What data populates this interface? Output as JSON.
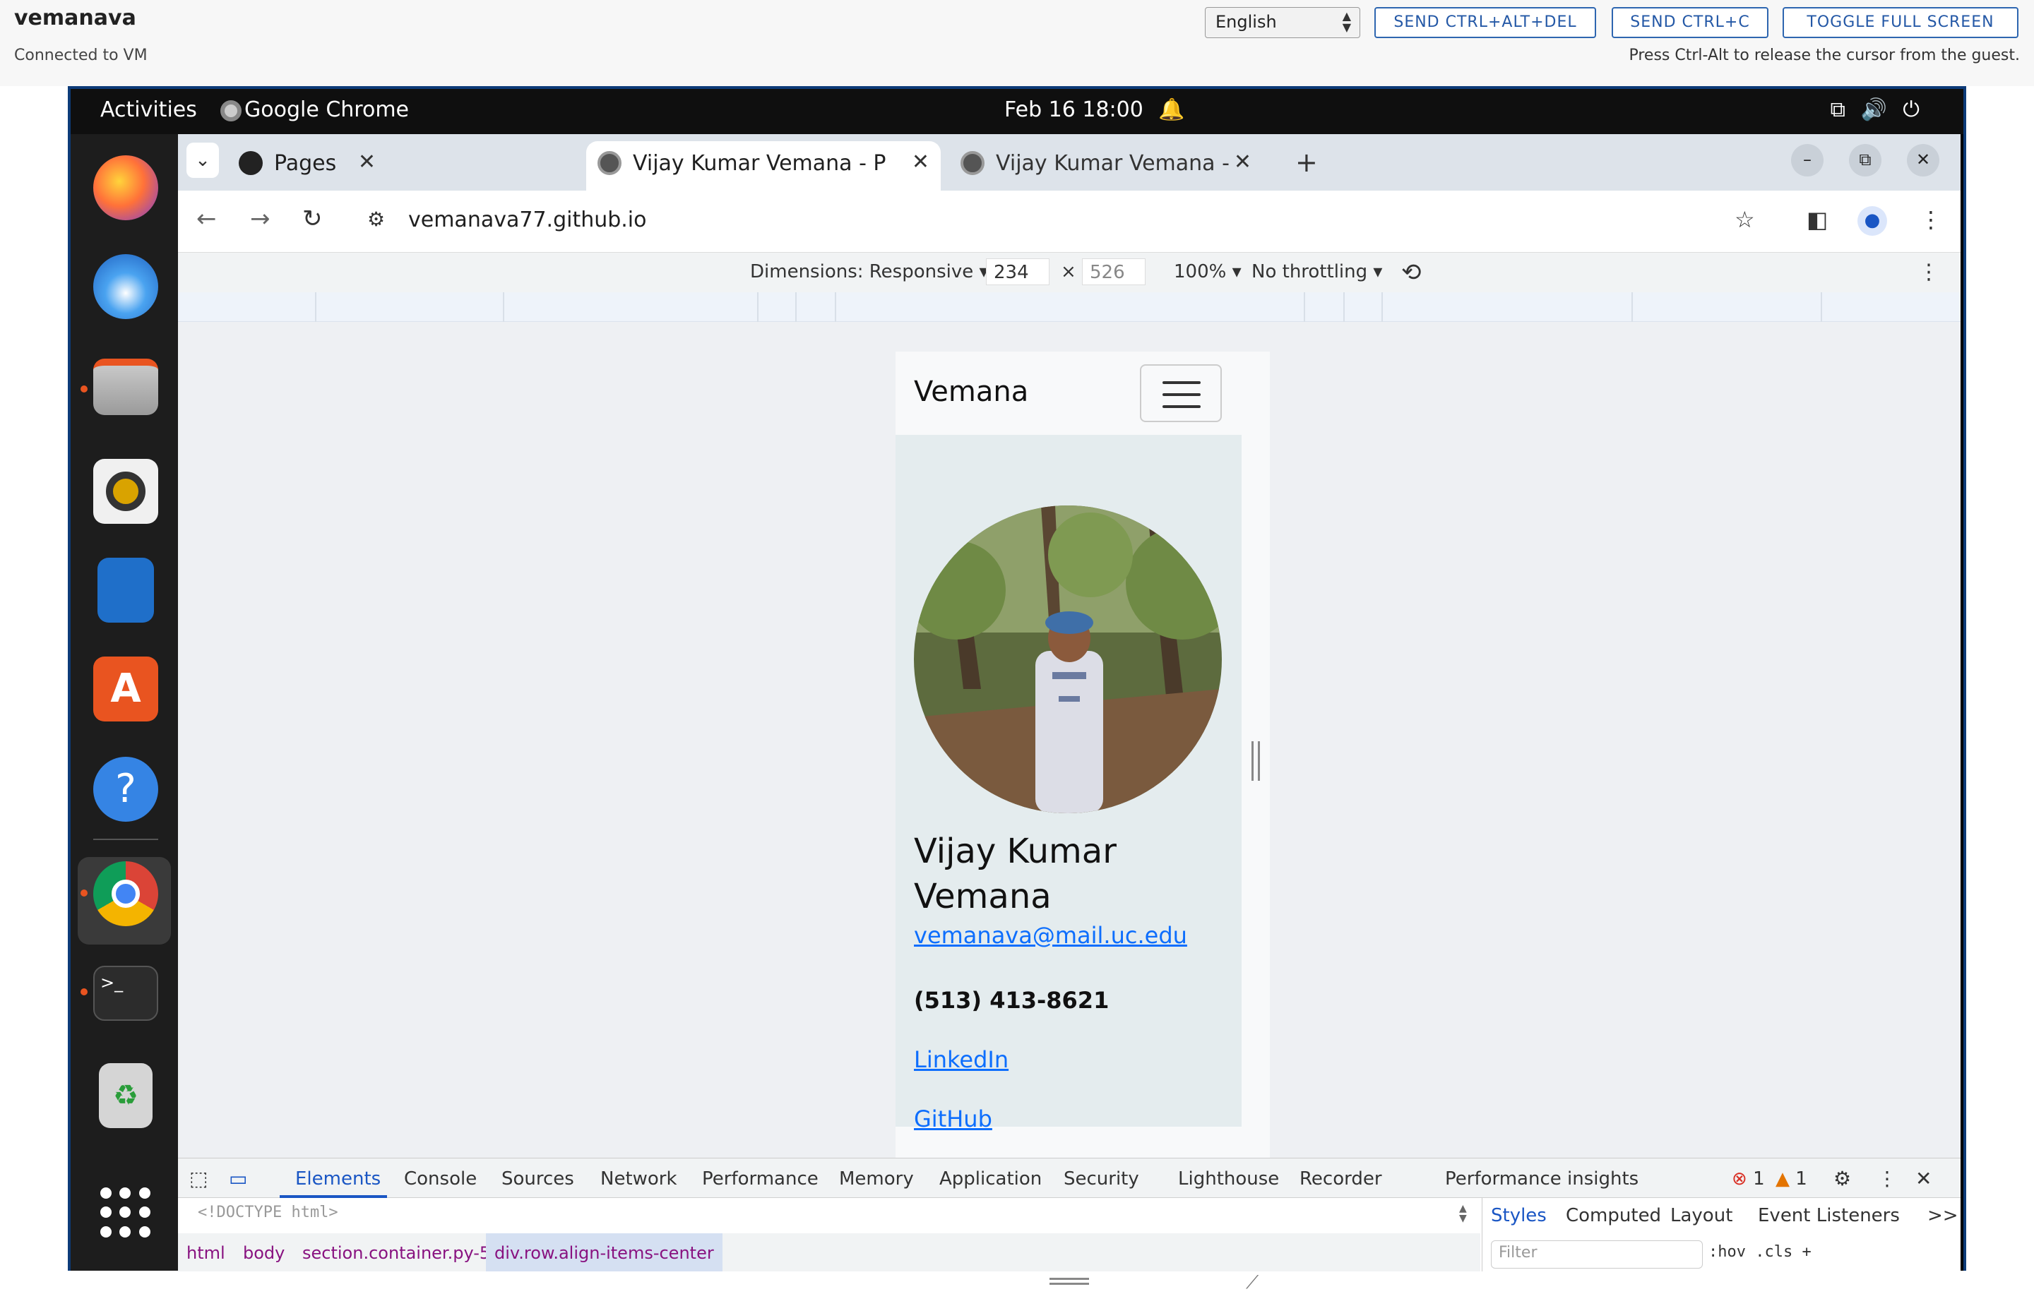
{
  "vm": {
    "title": "vemanava",
    "status": "Connected to VM",
    "language": "English",
    "buttons": [
      "SEND CTRL+ALT+DEL",
      "SEND CTRL+C",
      "TOGGLE FULL SCREEN"
    ],
    "hint": "Press Ctrl-Alt to release the cursor from the guest."
  },
  "topbar": {
    "activities": "Activities",
    "app": "Google Chrome",
    "clock": "Feb 16  18:00"
  },
  "dock": {
    "icons": [
      "firefox-icon",
      "thunderbird-icon",
      "files-icon",
      "rhythmbox-icon",
      "writer-icon",
      "app-center-icon",
      "help-icon",
      "chrome-icon",
      "terminal-icon",
      "trash-icon",
      "show-apps-icon"
    ]
  },
  "chrome": {
    "tabs": [
      {
        "label": "Pages",
        "active": false
      },
      {
        "label": "Vijay Kumar Vemana - Pr",
        "active": true
      },
      {
        "label": "Vijay Kumar Vemana - Pr",
        "active": false
      }
    ],
    "url": "vemanava77.github.io"
  },
  "device_toolbar": {
    "dimensions": "Dimensions: Responsive ▾",
    "width": "234",
    "times": "×",
    "height": "526",
    "zoom": "100% ▾",
    "throttle": "No throttling ▾"
  },
  "page": {
    "brand": "Vemana",
    "name": "Vijay Kumar Vemana",
    "email": "vemanava@mail.uc.edu",
    "phone": "(513) 413-8621",
    "linkedin": "LinkedIn",
    "github": "GitHub"
  },
  "devtools": {
    "tabs": [
      "Elements",
      "Console",
      "Sources",
      "Network",
      "Performance",
      "Memory",
      "Application",
      "Security",
      "Lighthouse",
      "Recorder",
      "Performance insights"
    ],
    "errors": "1",
    "warnings": "1",
    "dom_line": "<!DOCTYPE html>",
    "breadcrumbs": [
      "html",
      "body",
      "section.container.py-5",
      "div.row.align-items-center"
    ],
    "styles_tabs": [
      "Styles",
      "Computed",
      "Layout",
      "Event Listeners",
      ">>"
    ],
    "filter_placeholder": "Filter",
    "styles_tools": ":hov  .cls  +"
  },
  "colors": {
    "accent": "#1a56c4",
    "link": "#0d6efd",
    "ubuntu_orange": "#e95420"
  }
}
